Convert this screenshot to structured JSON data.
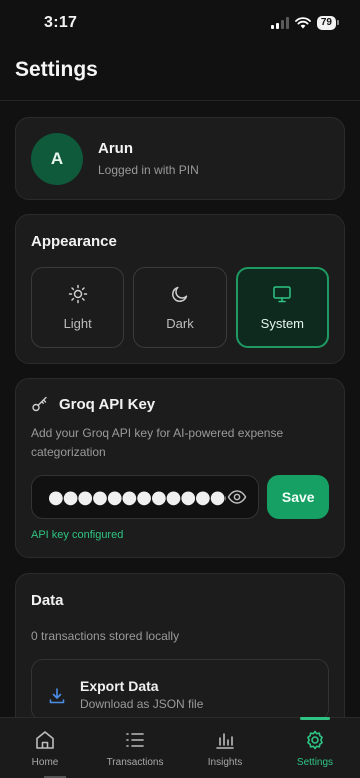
{
  "status_bar": {
    "time": "3:17",
    "battery": "79"
  },
  "page": {
    "title": "Settings"
  },
  "profile": {
    "avatar_letter": "A",
    "name": "Arun",
    "subtitle": "Logged in with PIN"
  },
  "appearance": {
    "title": "Appearance",
    "options": [
      {
        "label": "Light",
        "icon": "sun-icon"
      },
      {
        "label": "Dark",
        "icon": "moon-icon"
      },
      {
        "label": "System",
        "icon": "monitor-icon",
        "selected": true
      }
    ]
  },
  "api_key": {
    "title": "Groq API Key",
    "description": "Add your Groq API key for AI-powered expense categorization",
    "value": "●●●●●●●●●●●●●●●",
    "save_label": "Save",
    "status": "API key configured"
  },
  "data": {
    "title": "Data",
    "subtitle": "0 transactions stored locally",
    "export": {
      "title": "Export Data",
      "subtitle": "Download as JSON file"
    }
  },
  "nav": {
    "items": [
      {
        "label": "Home",
        "icon": "home-icon"
      },
      {
        "label": "Transactions",
        "icon": "list-icon"
      },
      {
        "label": "Insights",
        "icon": "bar-chart-icon"
      },
      {
        "label": "Settings",
        "icon": "gear-icon",
        "active": true
      }
    ]
  },
  "colors": {
    "accent": "#2fc483",
    "accent_dark": "#16a064",
    "background": "#111111",
    "card": "#1c1c1c"
  }
}
